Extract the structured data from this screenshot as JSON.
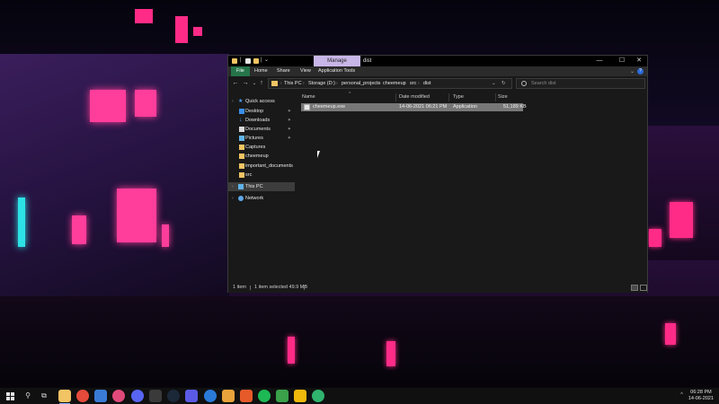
{
  "window": {
    "title": "dist",
    "manage_tab": "Manage",
    "minimize_glyph": "—",
    "maximize_glyph": "☐",
    "close_glyph": "✕"
  },
  "ribbon": {
    "tabs": [
      "File",
      "Home",
      "Share",
      "View",
      "Application Tools"
    ],
    "expand_glyph": "⌄",
    "help_glyph": "?"
  },
  "address": {
    "crumbs": [
      "This PC",
      "Storage (D:)",
      "personal_projects",
      "cheemeup",
      "src",
      "dist"
    ],
    "separator": "›",
    "search_placeholder": "Search dist"
  },
  "nav_pane": {
    "items": [
      {
        "label": "Quick access",
        "icon": "star-icon",
        "pinned": false
      },
      {
        "label": "Desktop",
        "icon": "desktop-icon",
        "pinned": true
      },
      {
        "label": "Downloads",
        "icon": "download-icon",
        "pinned": true
      },
      {
        "label": "Documents",
        "icon": "documents-icon",
        "pinned": true
      },
      {
        "label": "Pictures",
        "icon": "pictures-icon",
        "pinned": true
      },
      {
        "label": "Captures",
        "icon": "folder-icon",
        "pinned": false
      },
      {
        "label": "cheemeup",
        "icon": "folder-icon",
        "pinned": false
      },
      {
        "label": "important_documents",
        "icon": "folder-icon",
        "pinned": false
      },
      {
        "label": "src",
        "icon": "folder-icon",
        "pinned": false
      },
      {
        "label": "This PC",
        "icon": "computer-icon",
        "pinned": false
      },
      {
        "label": "Network",
        "icon": "network-icon",
        "pinned": false
      }
    ],
    "pin_glyph": "📌",
    "expand_glyph": "›"
  },
  "file_list": {
    "columns": [
      "Name",
      "Date modified",
      "Type",
      "Size"
    ],
    "rows": [
      {
        "name": "cheemeup.exe",
        "date_modified": "14-06-2021 06:21 PM",
        "type": "Application",
        "size": "51,189 KB"
      }
    ]
  },
  "status": {
    "item_count": "1 item",
    "selection": "1 item selected  49.9 MB"
  },
  "taskbar": {
    "time": "06:28 PM",
    "date": "14-06-2021",
    "tray_glyph": "^"
  },
  "colors": {
    "file_tab": "#26744a",
    "manage_tab": "#c9b6e8",
    "selected_row": "#777777",
    "folder": "#f2c464"
  }
}
